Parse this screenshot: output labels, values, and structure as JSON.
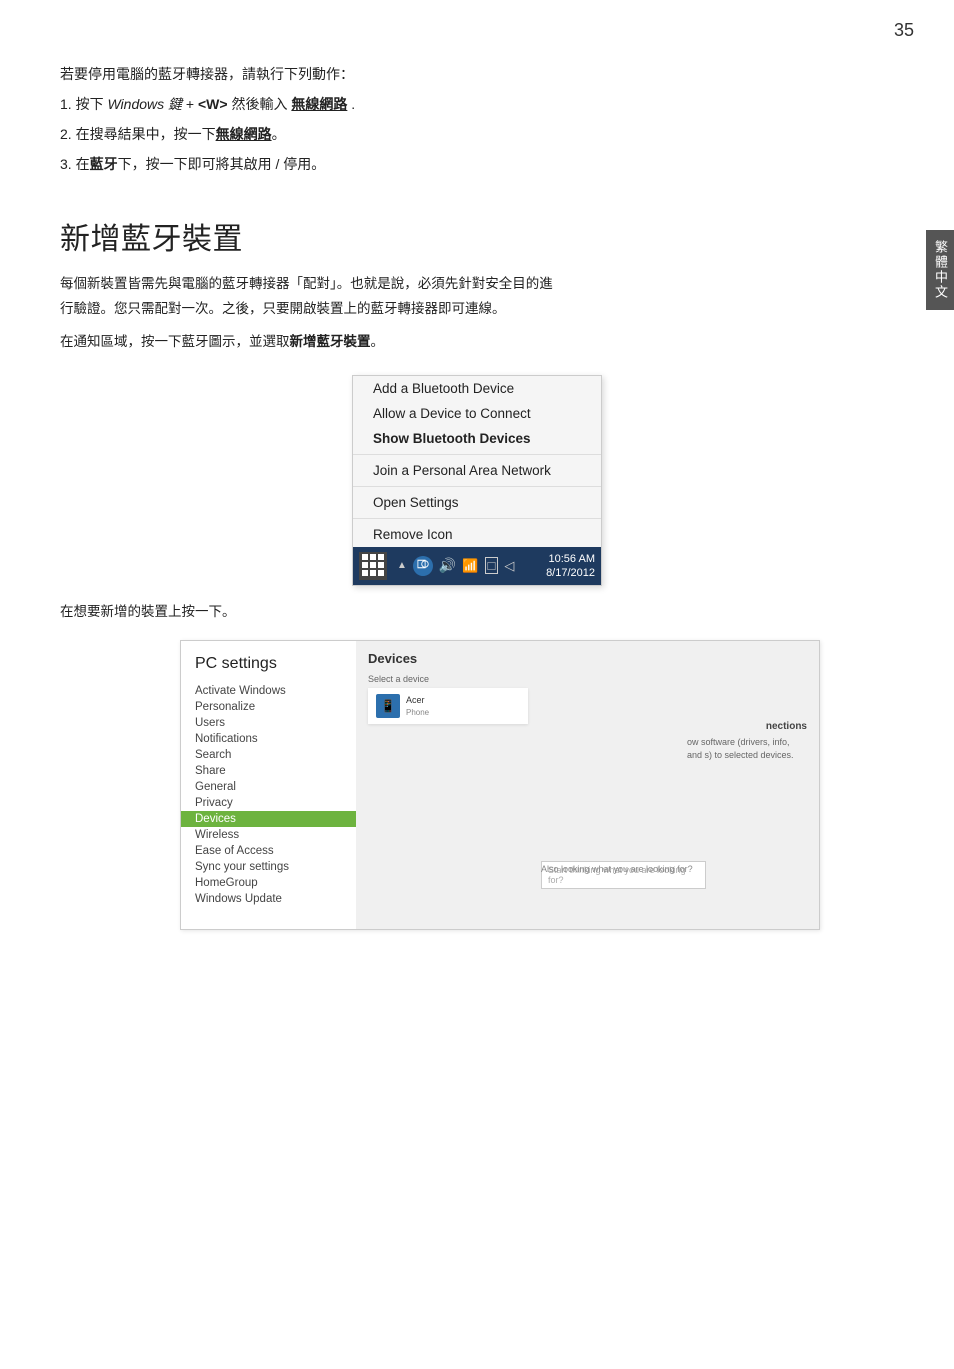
{
  "page": {
    "number": "35",
    "side_tab": "繁體中文"
  },
  "intro": {
    "line0": "若要停用電腦的藍牙轉接器，請執行下列動作：",
    "line1_prefix": "1.  按下 ",
    "line1_italic": "Windows 鍵",
    "line1_middle": " + ",
    "line1_bold": "<W>",
    "line1_suffix": " 然後輸入 ",
    "line1_underline_bold": "無線網路",
    "line1_end": " .",
    "line2_prefix": "2.  在搜尋結果中，按一下",
    "line2_bold": "無線網路",
    "line2_end": "。",
    "line3_prefix": "3.  在",
    "line3_bold": "藍牙",
    "line3_end": "下，按一下即可將其啟用 / 停用。"
  },
  "section": {
    "heading": "新增藍牙裝置",
    "body1": "每個新裝置皆需先與電腦的藍牙轉接器「配對」。也就是說，必須先針對安全目的進",
    "body2": "行驗證。您只需配對一次。之後，只要開啟裝置上的藍牙轉接器即可連線。",
    "body3_prefix": "在通知區域，按一下藍牙圖示，並選取",
    "body3_bold": "新增藍牙裝置",
    "body3_end": "。"
  },
  "context_menu": {
    "items": [
      {
        "label": "Add a Bluetooth Device",
        "bold": false
      },
      {
        "label": "Allow a Device to Connect",
        "bold": false
      },
      {
        "label": "Show Bluetooth Devices",
        "bold": true
      },
      {
        "label": "Join a Personal Area Network",
        "bold": false
      },
      {
        "label": "Open Settings",
        "bold": false
      },
      {
        "label": "Remove Icon",
        "bold": false
      }
    ]
  },
  "taskbar": {
    "time": "10:56 AM",
    "date": "8/17/2012"
  },
  "instruction": {
    "text": "在想要新增的裝置上按一下。"
  },
  "pc_settings": {
    "title": "PC settings",
    "nav_items": [
      "Activate Windows",
      "Personalize",
      "Users",
      "Notifications",
      "Search",
      "Share",
      "General",
      "Privacy",
      "Devices",
      "Wireless",
      "Ease of Access",
      "Sync your settings",
      "HomeGroup",
      "Windows Update"
    ],
    "active_item": "Devices",
    "content_title": "Devices",
    "device_name": "Acer",
    "device_sub": "Phone",
    "connections_title": "nections",
    "connections_desc": "ow software (drivers, info, and s) to selected devices.",
    "also_text": "Also looking what you are looking for?",
    "search_placeholder": "Start thinking what you are looking for?"
  }
}
